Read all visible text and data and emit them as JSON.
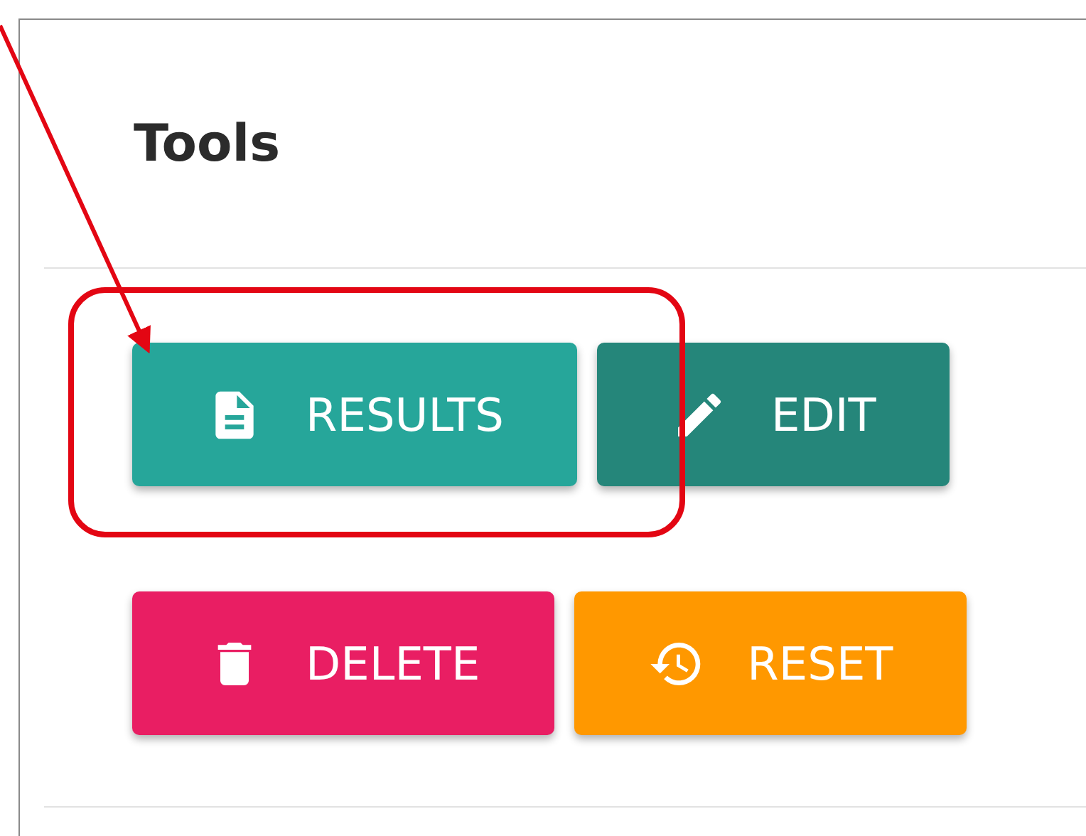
{
  "panel": {
    "title": "Tools"
  },
  "button_rows": [
    [
      {
        "label": "RESULTS",
        "kind": "document",
        "color": "#26a69a"
      },
      {
        "label": "EDIT",
        "kind": "pencil",
        "color": "#25867a"
      }
    ],
    [
      {
        "label": "DELETE",
        "kind": "trash",
        "color": "#e91e63"
      },
      {
        "label": "RESET",
        "kind": "restore",
        "color": "#ff9800"
      }
    ]
  ]
}
